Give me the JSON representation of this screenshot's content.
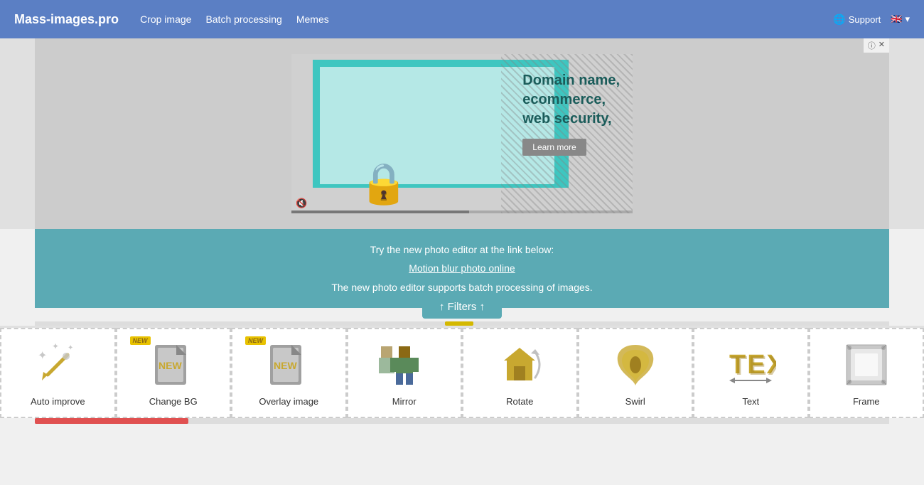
{
  "navbar": {
    "brand": "Mass-images.pro",
    "links": [
      {
        "label": "Crop image",
        "id": "crop-image"
      },
      {
        "label": "Batch processing",
        "id": "batch-processing"
      },
      {
        "label": "Memes",
        "id": "memes"
      }
    ],
    "support_label": "Support",
    "flag_alt": "UK Flag"
  },
  "ad": {
    "headline_line1": "Domain name,",
    "headline_line2": "ecommerce,",
    "headline_line3": "web security,",
    "learn_more": "Learn more",
    "info": "ⓘ ✕"
  },
  "promo": {
    "line1": "Try the new photo editor at the link below:",
    "link_text": "Motion blur photo online",
    "line2": "The new photo editor supports batch processing of images."
  },
  "filters_btn": "↑ Filters ↑",
  "tools": [
    {
      "id": "auto-improve",
      "label": "Auto improve",
      "icon": "✨",
      "new": false
    },
    {
      "id": "change-bg",
      "label": "Change BG",
      "icon": "🖼",
      "new": true
    },
    {
      "id": "overlay-image",
      "label": "Overlay image",
      "icon": "🗂",
      "new": true
    },
    {
      "id": "mirror",
      "label": "Mirror",
      "icon": "🪞",
      "new": false
    },
    {
      "id": "rotate",
      "label": "Rotate",
      "icon": "🔄",
      "new": false
    },
    {
      "id": "swirl",
      "label": "Swirl",
      "icon": "🌀",
      "new": false
    },
    {
      "id": "text",
      "label": "Text",
      "icon": "T",
      "new": false
    },
    {
      "id": "frame",
      "label": "Frame",
      "icon": "🖼",
      "new": false
    }
  ]
}
